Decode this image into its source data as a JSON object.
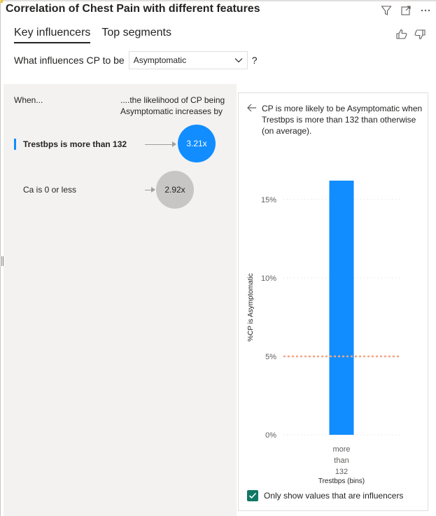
{
  "visual": {
    "title": "Correlation of Chest Pain with different features"
  },
  "header_icons": [
    "filter-icon",
    "focus-mode-icon",
    "more-options-icon"
  ],
  "tabs": [
    {
      "label": "Key influencers",
      "active": true
    },
    {
      "label": "Top segments",
      "active": false
    }
  ],
  "feedback_icons": [
    "thumbs-up-icon",
    "thumbs-down-icon"
  ],
  "question": {
    "prefix": "What influences CP to be",
    "selected": "Asymptomatic",
    "suffix": "?"
  },
  "influencers_panel": {
    "when_label": "When...",
    "likelihood_label": "....the likelihood of CP being Asymptomatic increases by",
    "items": [
      {
        "label": "Trestbps is more than 132",
        "value": "3.21x",
        "selected": true,
        "color": "#118dff"
      },
      {
        "label": "Ca is 0 or less",
        "value": "2.92x",
        "selected": false,
        "color": "#c8c6c4"
      }
    ]
  },
  "detail": {
    "text": "CP is more likely to be Asymptomatic when Trestbps is more than 132 than otherwise (on average).",
    "checkbox_label": "Only show values that are influencers",
    "checkbox_checked": true
  },
  "chart_data": {
    "type": "bar",
    "categories": [
      "more than 132"
    ],
    "category_lines": [
      "more",
      "than",
      "132"
    ],
    "values": [
      16.2
    ],
    "xlabel": "Trestbps (bins)",
    "ylabel": "%CP is Asymptomatic",
    "ylim": [
      0,
      16.2
    ],
    "yticks": [
      0,
      5,
      10,
      15
    ],
    "ytick_labels": [
      "0%",
      "5%",
      "10%",
      "15%"
    ],
    "reference_line": 5,
    "bar_color": "#118dff",
    "reference_color": "#f4a582",
    "grid": true
  }
}
